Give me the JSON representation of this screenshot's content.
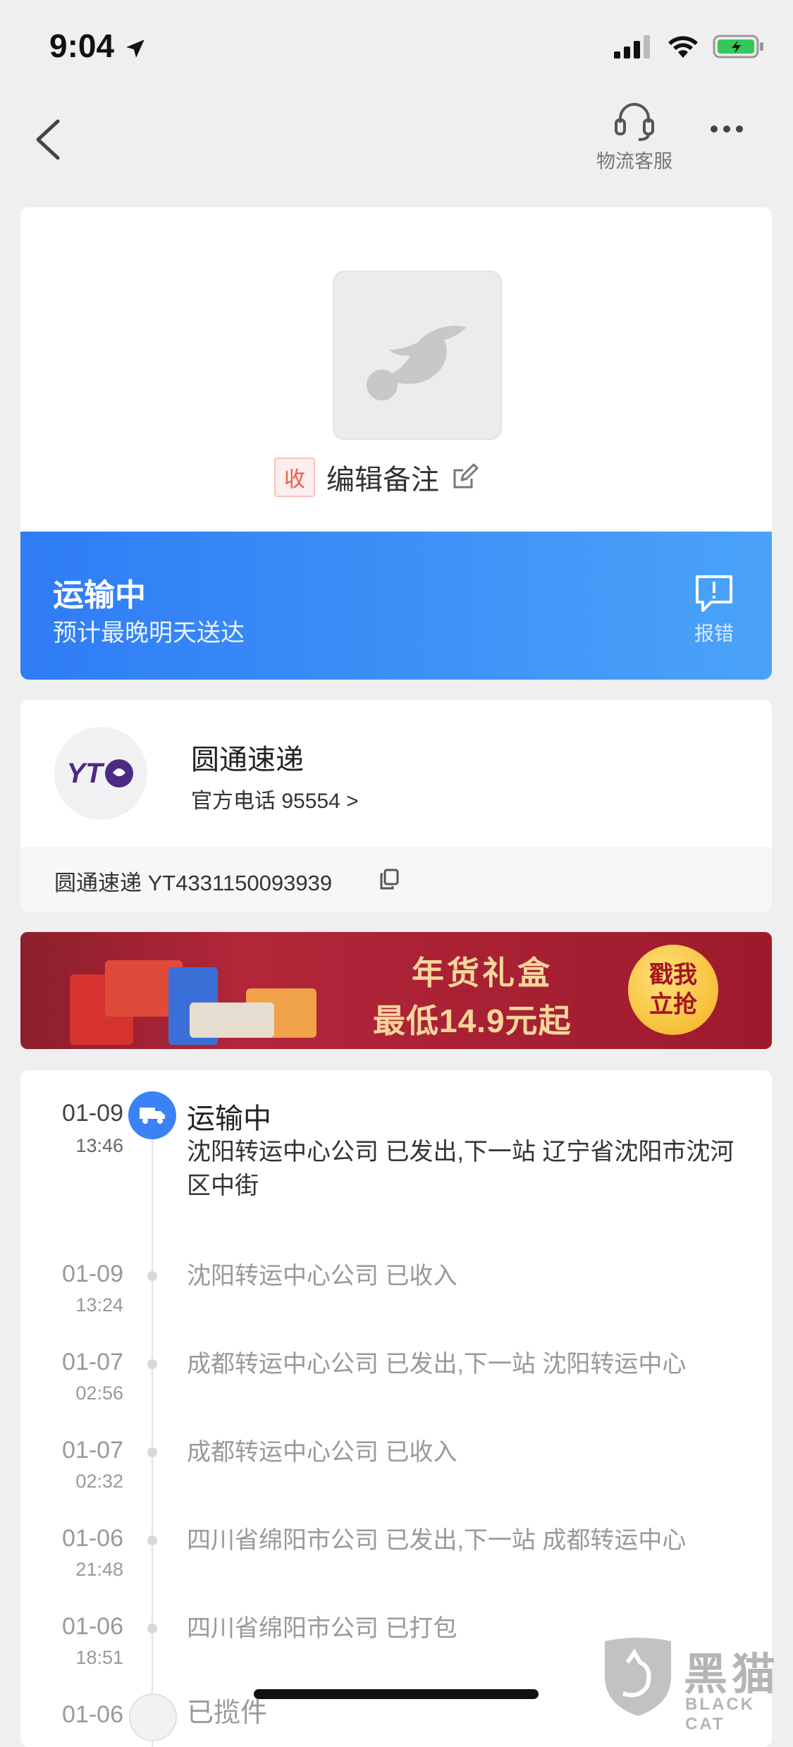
{
  "status_bar": {
    "time": "9:04"
  },
  "nav": {
    "service_label": "物流客服"
  },
  "package": {
    "receive_badge": "收",
    "edit_note": "编辑备注"
  },
  "status_banner": {
    "title": "运输中",
    "subtitle": "预计最晚明天送达",
    "report_label": "报错"
  },
  "courier": {
    "name": "圆通速递",
    "phone_text": "官方电话 95554 >",
    "tracking_text": "圆通速递 YT4331150093939",
    "logo_text": "YT"
  },
  "ad": {
    "line1": "年货礼盒",
    "line2": "最低14.9元起",
    "button": "戳我立抢"
  },
  "timeline": {
    "current": {
      "date": "01-09",
      "time": "13:46",
      "title": "运输中",
      "detail": "沈阳转运中心公司 已发出,下一站 辽宁省沈阳市沈河区中街"
    },
    "events": [
      {
        "date": "01-09",
        "time": "13:24",
        "text": "沈阳转运中心公司 已收入"
      },
      {
        "date": "01-07",
        "time": "02:56",
        "text": "成都转运中心公司 已发出,下一站 沈阳转运中心"
      },
      {
        "date": "01-07",
        "time": "02:32",
        "text": "成都转运中心公司 已收入"
      },
      {
        "date": "01-06",
        "time": "21:48",
        "text": "四川省绵阳市公司 已发出,下一站 成都转运中心"
      },
      {
        "date": "01-06",
        "time": "18:51",
        "text": "四川省绵阳市公司 已打包"
      }
    ],
    "last": {
      "date": "01-06",
      "title": "已揽件"
    }
  },
  "watermark": {
    "big": "黑猫",
    "small": "BLACK CAT"
  },
  "colors": {
    "accent": "#3b82f6",
    "badge_red": "#e85d4a"
  }
}
